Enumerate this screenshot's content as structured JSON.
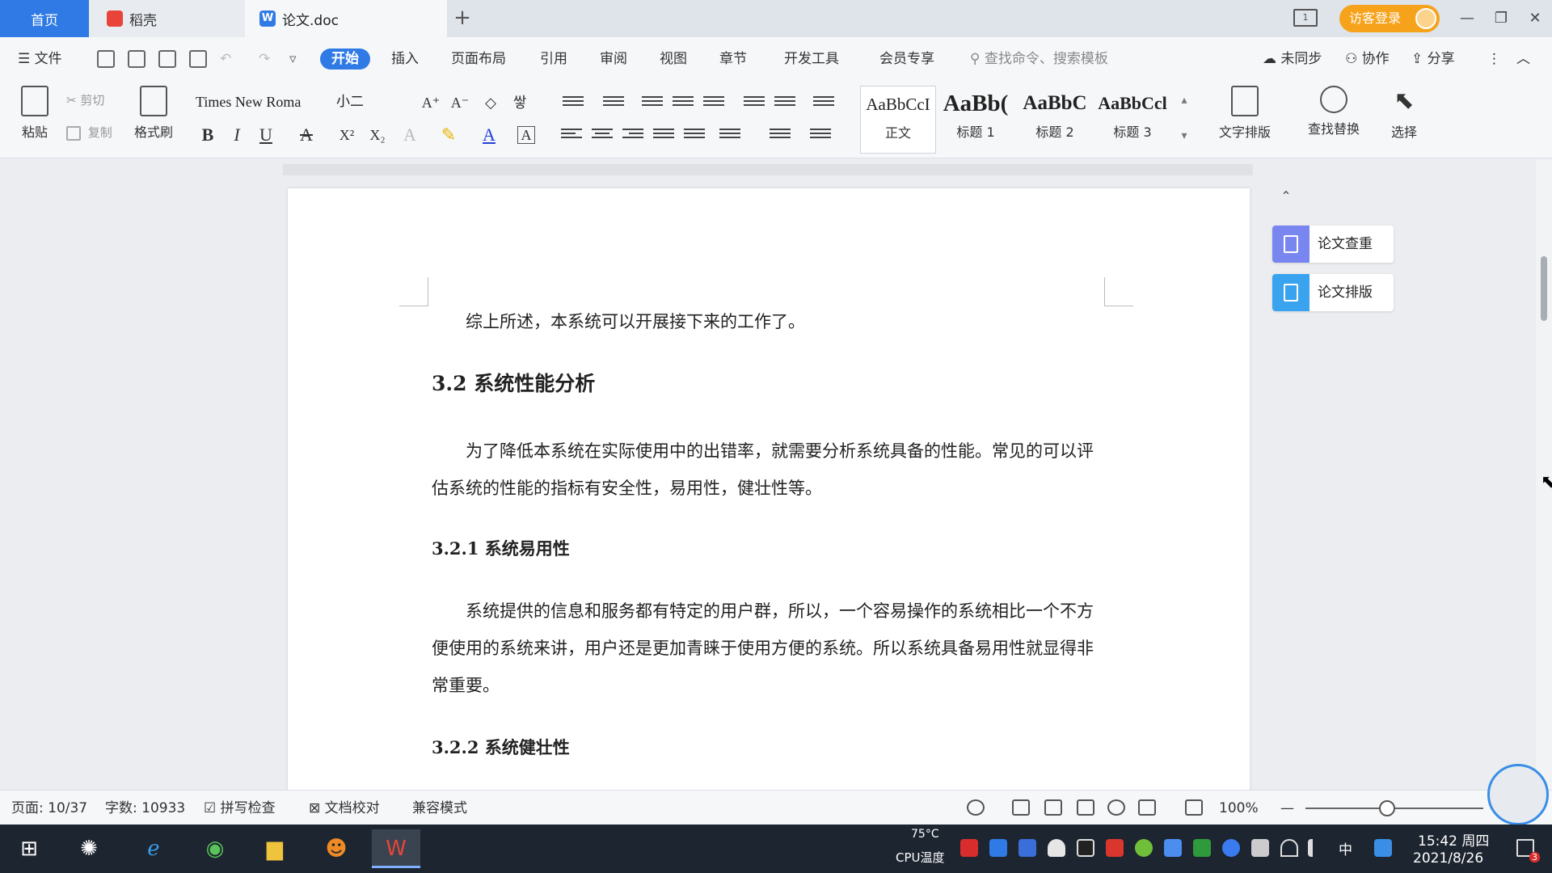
{
  "tabs": {
    "home": "首页",
    "docer": "稻壳",
    "doc": "论文.doc",
    "doc_icon": "W",
    "add": "+"
  },
  "titlebar": {
    "layout_toggle": "1",
    "login": "访客登录",
    "minimize": "—",
    "restore": "❐",
    "close": "✕"
  },
  "menu": {
    "file": "文件",
    "items": [
      "开始",
      "插入",
      "页面布局",
      "引用",
      "审阅",
      "视图",
      "章节",
      "开发工具",
      "会员专享"
    ],
    "search_placeholder": "查找命令、搜索模板",
    "sync": "未同步",
    "collab": "协作",
    "share": "分享",
    "more": "⋮",
    "collapse": "︿"
  },
  "toolbar": {
    "paste": "粘贴",
    "cut": "剪切",
    "copy": "复制",
    "format_painter": "格式刷",
    "font_name": "Times New Roma",
    "font_size": "小二",
    "bold": "B",
    "italic": "I",
    "underline": "U",
    "strike": "A",
    "superscript": "X²",
    "subscript": "X₂",
    "grow_font": "A⁺",
    "shrink_font": "A⁻",
    "font_color_letter": "A",
    "char_border": "A",
    "phonetic": "쌓",
    "styles": [
      {
        "sample": "AaBbCcI",
        "name": "正文"
      },
      {
        "sample": "AaBb(",
        "name": "标题 1"
      },
      {
        "sample": "AaBbC",
        "name": "标题 2"
      },
      {
        "sample": "AaBbCcl",
        "name": "标题 3"
      }
    ],
    "text_layout": "文字排版",
    "find_replace": "查找替换",
    "select": "选择"
  },
  "document": {
    "p1": "综上所述，本系统可以开展接下来的工作了。",
    "h_32": "3.2 系统性能分析",
    "p2": "为了降低本系统在实际使用中的出错率，就需要分析系统具备的性能。常见的可以评估系统的性能的指标有安全性，易用性，健壮性等。",
    "h_321": "3.2.1 系统易用性",
    "p3": "系统提供的信息和服务都有特定的用户群，所以，一个容易操作的系统相比一个不方便使用的系统来讲，用户还是更加青睐于使用方便的系统。所以系统具备易用性就显得非常重要。",
    "h_322": "3.2.2 系统健壮性"
  },
  "side_panel": {
    "collapse": "⌃",
    "check": "论文查重",
    "format": "论文排版"
  },
  "status": {
    "page": "页面: 10/37",
    "words": "字数: 10933",
    "spell": "拼写检查",
    "proof": "文档校对",
    "compat": "兼容模式",
    "zoom": "100%",
    "zoom_out": "—",
    "zoom_in": "+"
  },
  "taskbar": {
    "cpu_temp": "75°C",
    "cpu_label": "CPU温度",
    "ime": "中",
    "time": "15:42 周四",
    "date": "2021/8/26",
    "notify_count": "3"
  },
  "colors": {
    "accent": "#2f7ae5",
    "login": "#f6a21a"
  }
}
